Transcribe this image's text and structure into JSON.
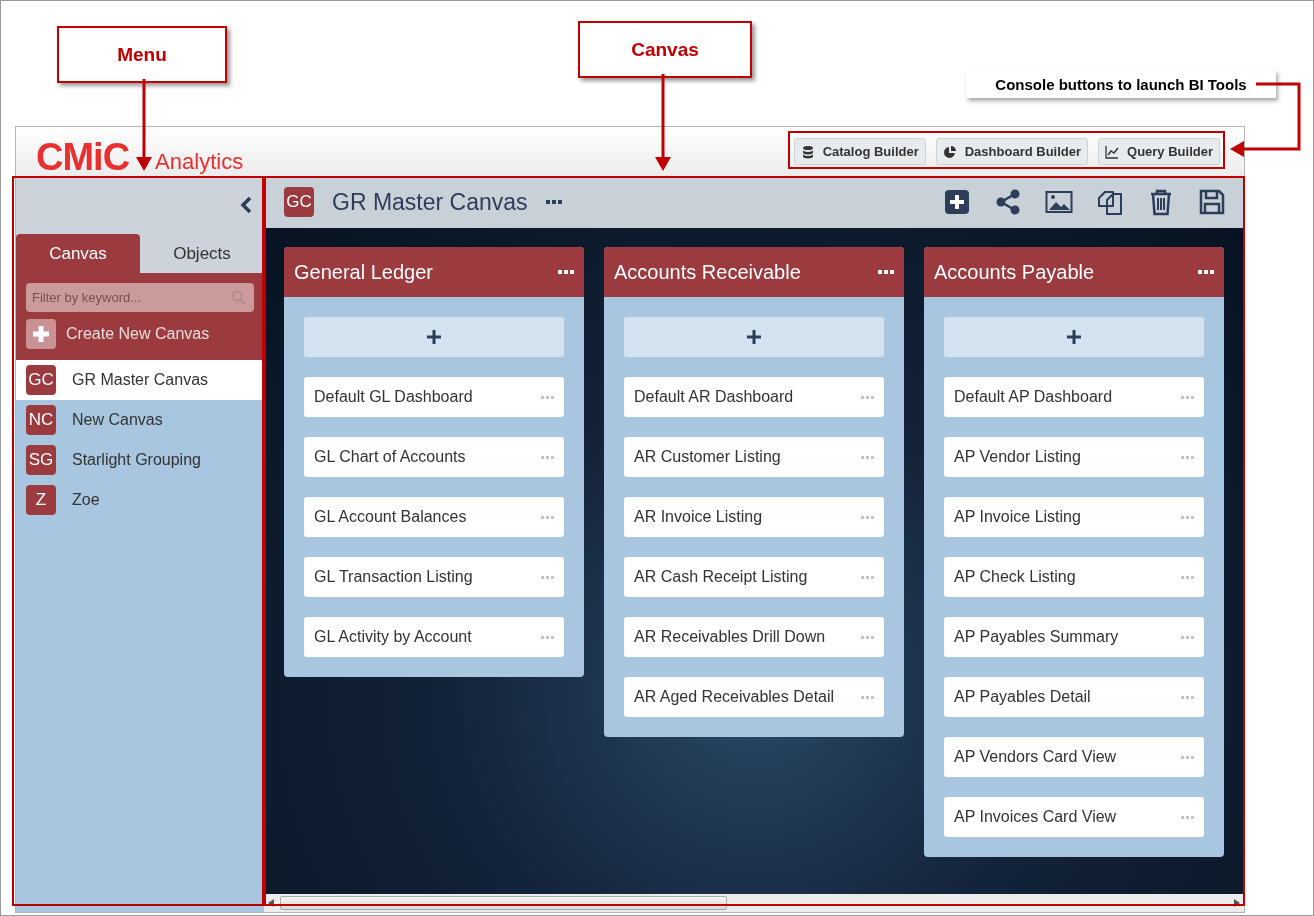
{
  "annotations": [
    {
      "kind": "box",
      "label": "Menu"
    },
    {
      "kind": "box",
      "label": "Canvas"
    },
    {
      "kind": "note",
      "label": "Console buttons to launch BI Tools"
    }
  ],
  "header": {
    "logo": "CMiC",
    "product": "Analytics",
    "console_buttons": [
      {
        "label": "Catalog Builder"
      },
      {
        "label": "Dashboard Builder"
      },
      {
        "label": "Query Builder"
      }
    ]
  },
  "sidebar": {
    "tabs": [
      {
        "label": "Canvas",
        "selected": true
      },
      {
        "label": "Objects",
        "selected": false
      }
    ],
    "search": {
      "placeholder": "Filter by keyword..."
    },
    "create_label": "Create New Canvas",
    "items": [
      {
        "initials": "GC",
        "label": "GR Master Canvas",
        "selected": true
      },
      {
        "initials": "NC",
        "label": "New Canvas",
        "selected": false
      },
      {
        "initials": "SG",
        "label": "Starlight Grouping",
        "selected": false
      },
      {
        "initials": "Z",
        "label": "Zoe",
        "selected": false
      }
    ]
  },
  "canvas": {
    "initials": "GC",
    "title": "GR Master Canvas",
    "boards": [
      {
        "title": "General Ledger",
        "items": [
          "Default GL Dashboard",
          "GL Chart of Accounts",
          "GL Account Balances",
          "GL Transaction Listing",
          "GL Activity by Account"
        ]
      },
      {
        "title": "Accounts Receivable",
        "items": [
          "Default AR Dashboard",
          "AR Customer Listing",
          "AR Invoice Listing",
          "AR Cash Receipt Listing",
          "AR Receivables Drill Down",
          "AR Aged Receivables Detail"
        ]
      },
      {
        "title": "Accounts Payable",
        "items": [
          "Default AP Dashboard",
          "AP Vendor Listing",
          "AP Invoice Listing",
          "AP Check Listing",
          "AP Payables Summary",
          "AP Payables Detail",
          "AP Vendors Card View",
          "AP Invoices Card View"
        ]
      }
    ]
  }
}
